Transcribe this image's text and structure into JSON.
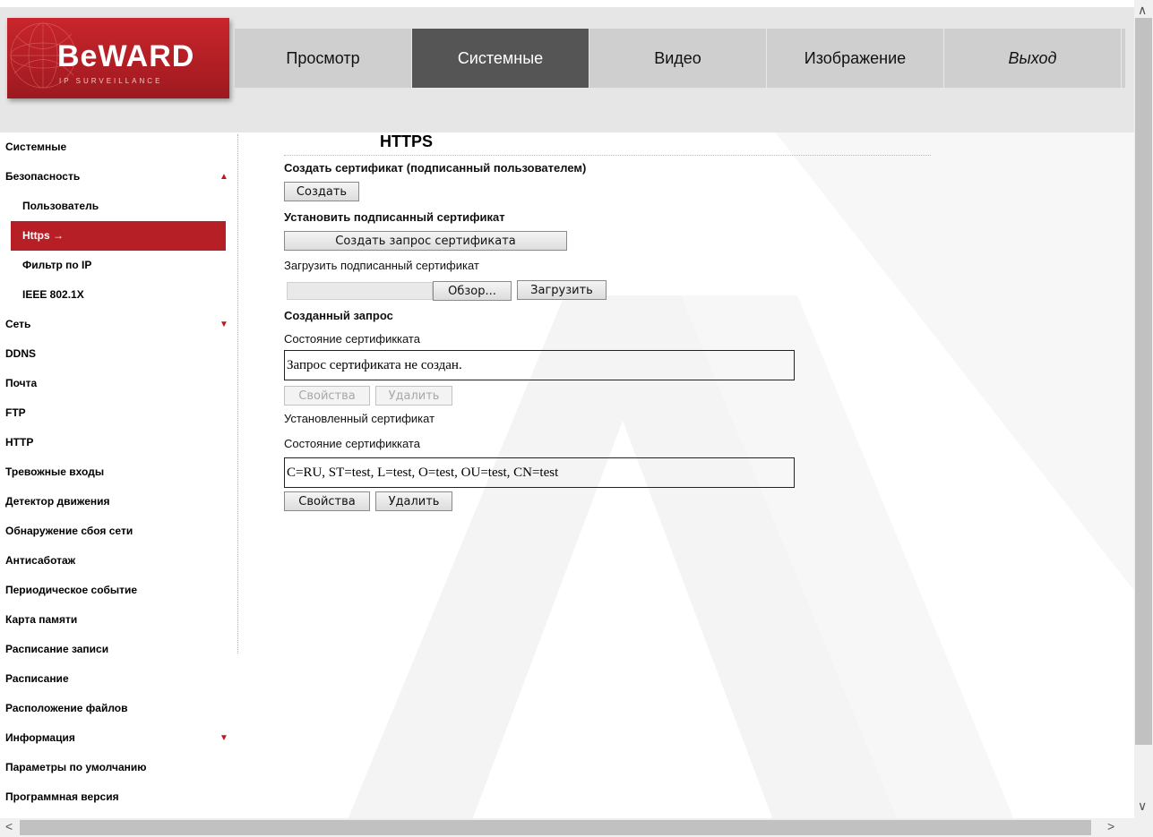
{
  "logo": {
    "brand": "BeWARD",
    "sub": "IP SURVEILLANCE"
  },
  "nav": [
    {
      "label": "Просмотр"
    },
    {
      "label": "Системные",
      "active": true
    },
    {
      "label": "Видео"
    },
    {
      "label": "Изображение"
    },
    {
      "label": "Выход"
    }
  ],
  "sidebar": {
    "items": [
      {
        "label": "Системные"
      },
      {
        "label": "Безопасность",
        "expanded": true
      },
      {
        "label": "Пользователь"
      },
      {
        "label": "Https",
        "active": true,
        "arrow": "→"
      },
      {
        "label": "Фильтр по IP"
      },
      {
        "label": "IEEE 802.1X"
      },
      {
        "label": "Сеть",
        "collapsed": true
      },
      {
        "label": "DDNS"
      },
      {
        "label": "Почта"
      },
      {
        "label": "FTP"
      },
      {
        "label": "HTTP"
      },
      {
        "label": "Тревожные входы"
      },
      {
        "label": "Детектор движения"
      },
      {
        "label": "Обнаружение сбоя сети"
      },
      {
        "label": "Антисаботаж"
      },
      {
        "label": "Периодическое событие"
      },
      {
        "label": "Карта памяти"
      },
      {
        "label": "Расписание записи"
      },
      {
        "label": "Расписание"
      },
      {
        "label": "Расположение файлов"
      },
      {
        "label": "Информация",
        "collapsed": true
      },
      {
        "label": "Параметры по умолчанию"
      },
      {
        "label": "Программная версия"
      }
    ]
  },
  "main": {
    "title": "HTTPS",
    "create_cert_heading": "Создать сертификат (подписанный пользователем)",
    "create_button": "Создать",
    "install_signed_heading": "Установить подписанный сертификат",
    "create_request_button": "Создать запрос сертификата",
    "upload_signed_label": "Загрузить подписанный сертификат",
    "browse_button": "Обзор...",
    "upload_button": "Загрузить",
    "created_request_heading": "Созданный запрос",
    "request_status_label": "Состояние сертификката",
    "request_status_value": "Запрос сертификата не создан.",
    "request_properties_button": "Свойства",
    "request_delete_button": "Удалить",
    "installed_cert_label": "Установленный сертификат",
    "installed_status_label": "Состояние сертификката",
    "installed_status_value": "C=RU, ST=test, L=test, O=test, OU=test, CN=test",
    "installed_properties_button": "Свойства",
    "installed_delete_button": "Удалить"
  },
  "colors": {
    "accent": "#b61f26",
    "nav_active": "#555555",
    "header_bg": "#e6e6e6"
  }
}
